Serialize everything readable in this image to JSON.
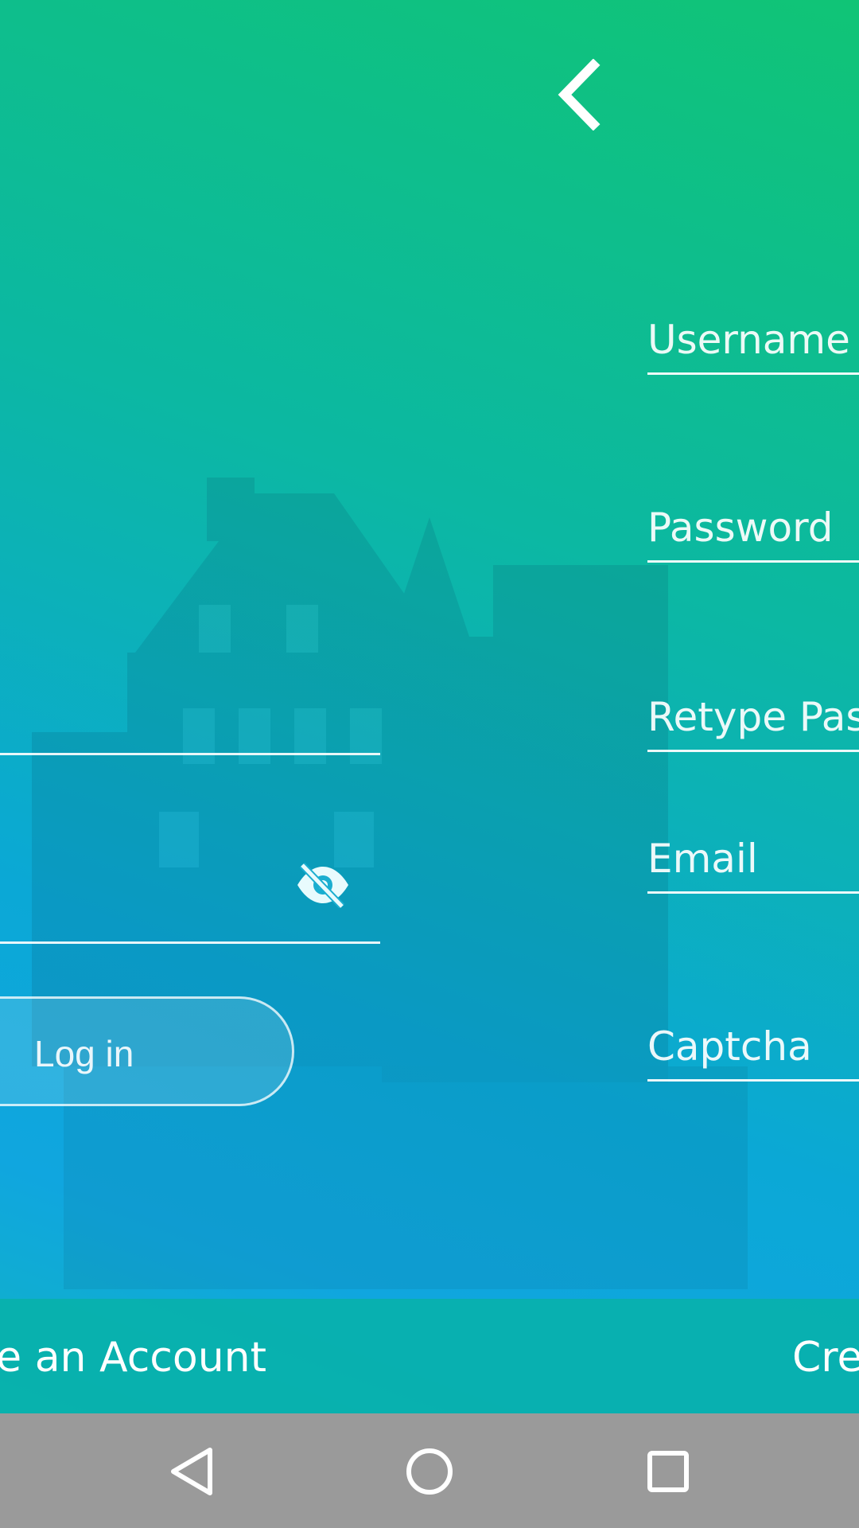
{
  "header": {
    "back_icon": "chevron-left-icon"
  },
  "register_form": {
    "username_placeholder": "Username",
    "password_placeholder": "Password",
    "retype_password_placeholder": "Retype Pas",
    "email_placeholder": "Email",
    "captcha_placeholder": "Captcha"
  },
  "login_form": {
    "password_visibility_icon": "eye-off-icon",
    "login_button_label": "Log in"
  },
  "bottom_bar": {
    "left_link_label": "te an Account",
    "right_link_label": "Cre"
  },
  "nav_bar": {
    "back": "nav-back-icon",
    "home": "nav-home-icon",
    "recents": "nav-recents-icon"
  },
  "colors": {
    "gradient_top": "#10c476",
    "gradient_mid": "#0ba8d6",
    "nav_bar": "#9a9a9a"
  }
}
